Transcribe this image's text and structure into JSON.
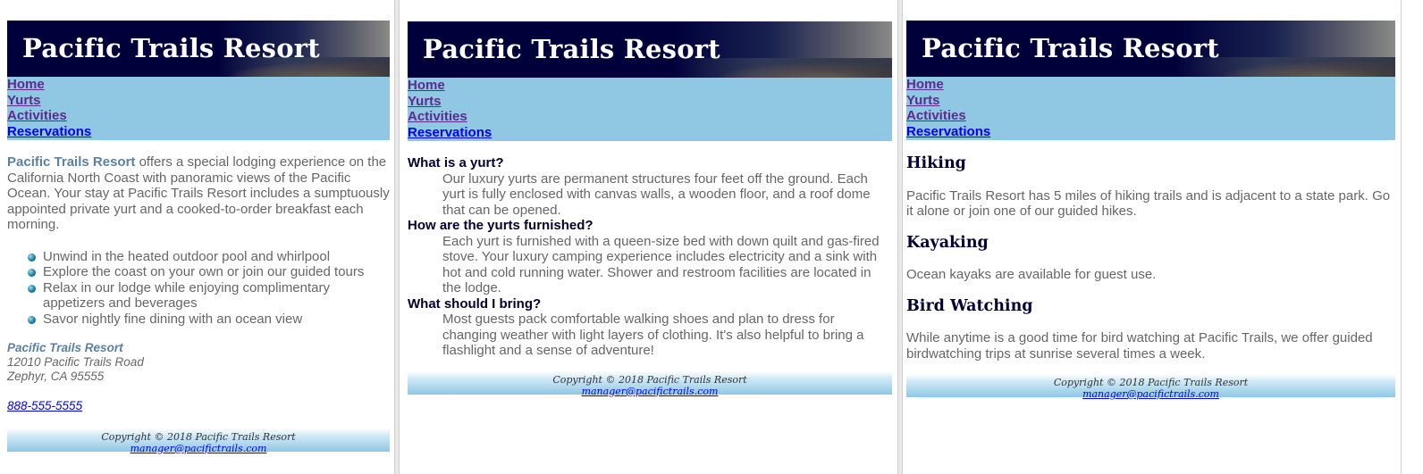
{
  "site": {
    "title": "Pacific Trails Resort",
    "nav": [
      "Home",
      "Yurts",
      "Activities",
      "Reservations"
    ]
  },
  "footer": {
    "copyright": "Copyright © 2018 Pacific Trails Resort",
    "email": "manager@pacifictrails.com"
  },
  "home": {
    "intro_brand": "Pacific Trails Resort",
    "intro_text": " offers a special lodging experience on the California North Coast with panoramic views of the Pacific Ocean. Your stay at Pacific Trails Resort includes a sumptuously appointed private yurt and a cooked-to-order breakfast each morning.",
    "features": [
      "Unwind in the heated outdoor pool and whirlpool",
      "Explore the coast on your own or join our guided tours",
      "Relax in our lodge while enjoying complimentary appetizers and beverages",
      "Savor nightly fine dining with an ocean view"
    ],
    "address": {
      "org": "Pacific Trails Resort",
      "street": "12010 Pacific Trails Road",
      "city": "Zephyr, CA 95555"
    },
    "phone": "888-555-5555"
  },
  "yurts": {
    "faq": [
      {
        "q": "What is a yurt?",
        "a": "Our luxury yurts are permanent structures four feet off the ground. Each yurt is fully enclosed with canvas walls, a wooden floor, and a roof dome that can be opened."
      },
      {
        "q": "How are the yurts furnished?",
        "a": "Each yurt is furnished with a queen-size bed with down quilt and gas-fired stove. Your luxury camping experience includes electricity and a sink with hot and cold running water. Shower and restroom facilities are located in the lodge."
      },
      {
        "q": "What should I bring?",
        "a": "Most guests pack comfortable walking shoes and plan to dress for changing weather with light layers of clothing. It's also helpful to bring a flashlight and a sense of adventure!"
      }
    ]
  },
  "activities": {
    "sections": [
      {
        "heading": "Hiking",
        "text": "Pacific Trails Resort has 5 miles of hiking trails and is adjacent to a state park. Go it alone or join one of our guided hikes."
      },
      {
        "heading": "Kayaking",
        "text": "Ocean kayaks are available for guest use."
      },
      {
        "heading": "Bird Watching",
        "text": "While anytime is a good time for bird watching at Pacific Trails, we offer guided birdwatching trips at sunrise several times a week."
      }
    ]
  },
  "colors": {
    "header_bg": "#00003b",
    "nav_bg": "#90c7e3",
    "visited_link": "#5c2b8e",
    "link": "#0000ee",
    "brand_text": "#5c7fa3",
    "body_text": "#666666"
  }
}
